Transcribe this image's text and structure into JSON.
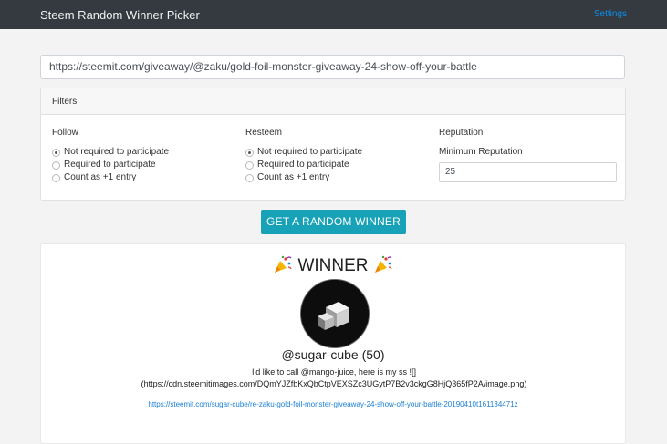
{
  "navbar": {
    "brand": "Steem Random Winner Picker",
    "settings_label": "Settings"
  },
  "url_input": {
    "value": "https://steemit.com/giveaway/@zaku/gold-foil-monster-giveaway-24-show-off-your-battle"
  },
  "filters": {
    "title": "Filters",
    "follow": {
      "label": "Follow",
      "options": [
        {
          "label": "Not required to participate",
          "checked": true
        },
        {
          "label": "Required to participate",
          "checked": false
        },
        {
          "label": "Count as +1 entry",
          "checked": false
        }
      ]
    },
    "resteem": {
      "label": "Resteem",
      "options": [
        {
          "label": "Not required to participate",
          "checked": true
        },
        {
          "label": "Required to participate",
          "checked": false
        },
        {
          "label": "Count as +1 entry",
          "checked": false
        }
      ]
    },
    "reputation": {
      "label": "Reputation",
      "min_label": "Minimum Reputation",
      "value": "25"
    }
  },
  "action": {
    "button_label": "GET A RANDOM WINNER"
  },
  "winner": {
    "heading": "WINNER",
    "icon": "party-popper-icon",
    "name": "@sugar-cube (50)",
    "comment_line1": "I'd like to call @mango-juice, here is my ss ![]",
    "comment_line2": "(https://cdn.steemitimages.com/DQmYJZfbKxQbCtpVEXSZc3UGytP7B2v3ckgG8HjQ365fP2A/image.png)",
    "link": "https://steemit.com/sugar-cube/re-zaku-gold-foil-monster-giveaway-24-show-off-your-battle-20190410t161134471z"
  },
  "colors": {
    "navbar": "#343a40",
    "accent_button": "#17a2b8",
    "link": "#1a7fd4"
  }
}
